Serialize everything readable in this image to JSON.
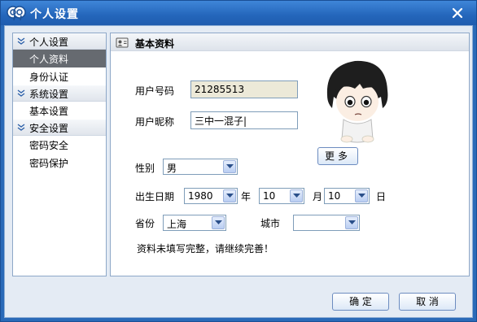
{
  "window": {
    "title": "个人设置",
    "logo_icon": "qq-logo-icon",
    "close_icon": "close-icon"
  },
  "nav": {
    "groups": [
      {
        "label": "个人设置",
        "items": [
          {
            "label": "个人资料",
            "active": true
          },
          {
            "label": "身份认证"
          }
        ]
      },
      {
        "label": "系统设置",
        "items": [
          {
            "label": "基本设置"
          }
        ]
      },
      {
        "label": "安全设置",
        "items": [
          {
            "label": "密码安全"
          },
          {
            "label": "密码保护"
          }
        ]
      }
    ]
  },
  "content": {
    "header_title": "基本资料",
    "header_icon": "profile-card-icon",
    "qq_number_label": "用户号码",
    "qq_number_value": "21285513",
    "nickname_label": "用户昵称",
    "nickname_value": "三中一混子|",
    "more_button": "更多",
    "gender_label": "性别",
    "gender_value": "男",
    "birthday_label": "出生日期",
    "birth_year": "1980",
    "year_unit": "年",
    "birth_month": "10",
    "month_unit": "月",
    "birth_day": "10",
    "day_unit": "日",
    "province_label": "省份",
    "province_value": "上海",
    "city_label": "城市",
    "city_value": "",
    "notice": "资料未填写完整，请继续完善！",
    "avatar_icon": "cartoon-avatar-icon"
  },
  "footer": {
    "ok_button": "确 定",
    "cancel_button": "取 消"
  },
  "colors": {
    "titlebar": "#2466bb",
    "active_nav": "#666a70",
    "panel_bg": "#e4ebf4"
  }
}
